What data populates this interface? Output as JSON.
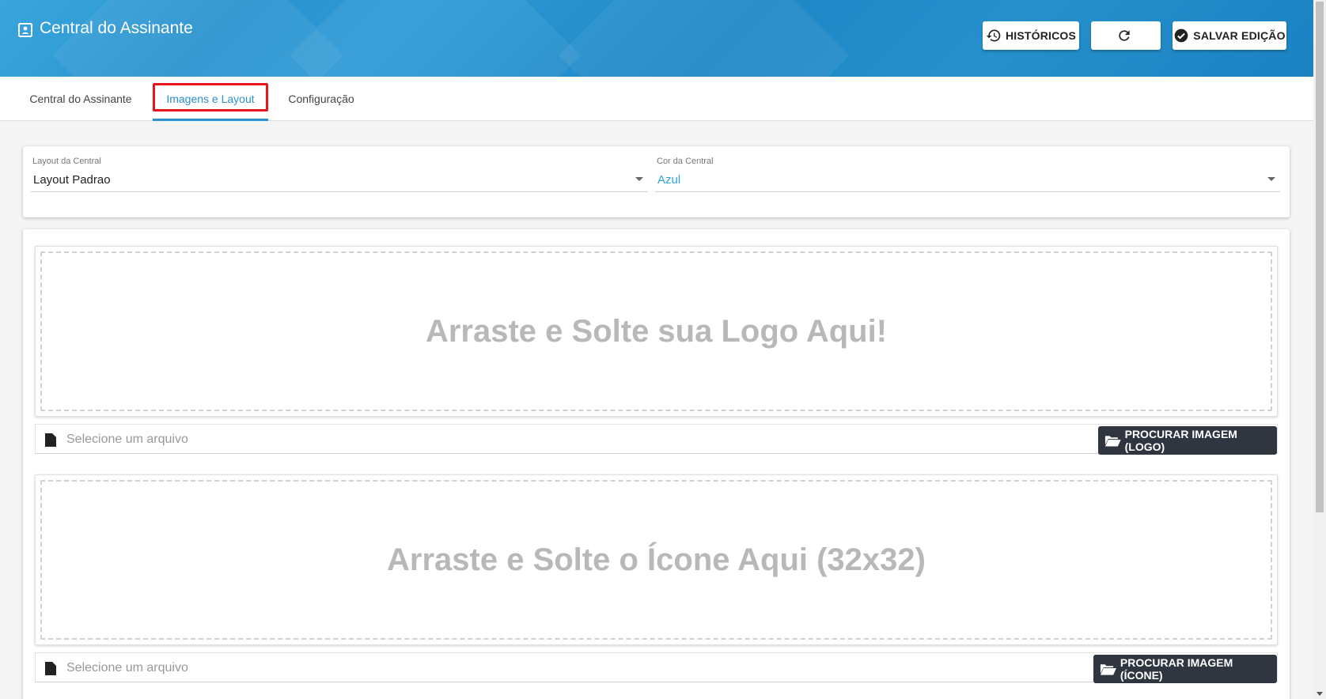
{
  "header": {
    "title": "Central do Assinante",
    "buttons": {
      "historicos": "HISTÓRICOS",
      "salvar": "SALVAR EDIÇÃO"
    }
  },
  "tabs": [
    {
      "label": "Central do Assinante",
      "active": false
    },
    {
      "label": "Imagens e Layout",
      "active": true
    },
    {
      "label": "Configuração",
      "active": false
    }
  ],
  "selects": {
    "layout": {
      "label": "Layout da Central",
      "value": "Layout Padrao"
    },
    "cor": {
      "label": "Cor da Central",
      "value": "Azul"
    }
  },
  "uploads": {
    "logo": {
      "drop_text": "Arraste e Solte sua Logo Aqui!",
      "placeholder": "Selecione um arquivo",
      "button": "PROCURAR IMAGEM (LOGO)"
    },
    "icone": {
      "drop_text": "Arraste e Solte o Ícone Aqui (32x32)",
      "placeholder": "Selecione um arquivo",
      "button": "PROCURAR IMAGEM (ÍCONE)"
    }
  },
  "colors": {
    "header": "#2290cc",
    "accent": "#2a8fcf",
    "highlight_box": "#e8141b",
    "dark_button": "#2f3640"
  }
}
